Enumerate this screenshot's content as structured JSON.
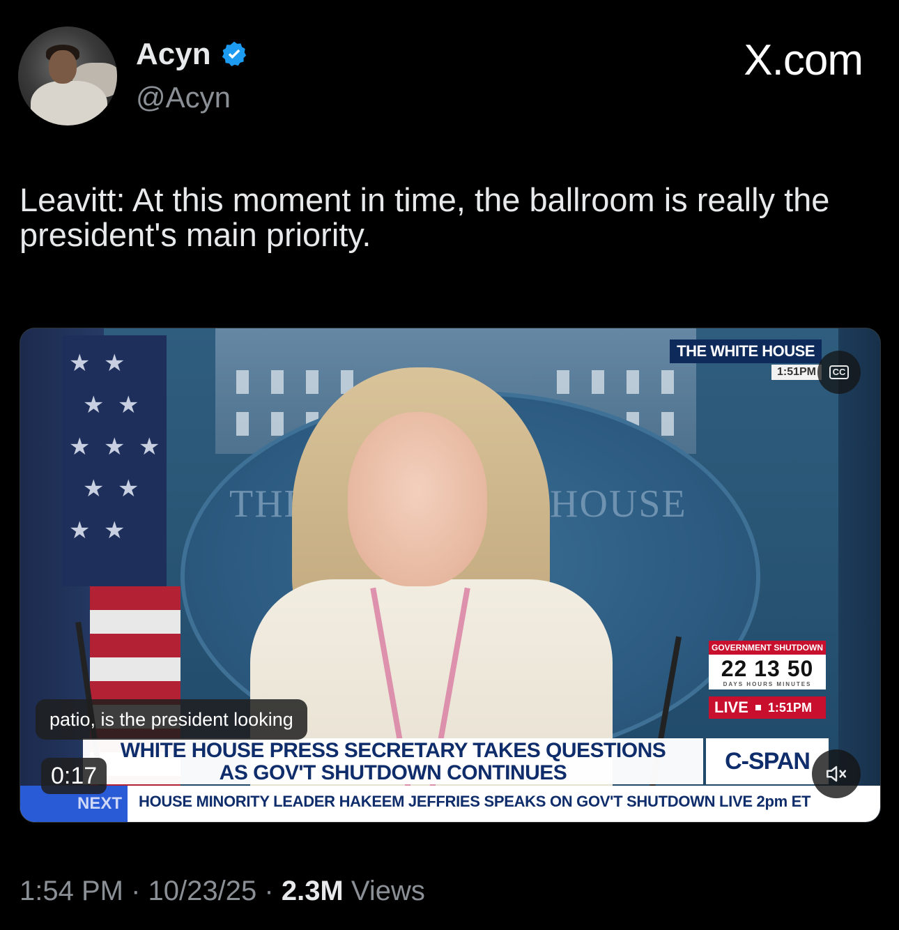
{
  "author": {
    "display_name": "Acyn",
    "handle": "@Acyn",
    "verified": true
  },
  "site_mark": "X.com",
  "tweet": {
    "text": "Leavitt: At this moment in time, the ballroom is really the president's main priority."
  },
  "video": {
    "overlay_top_label": "THE WHITE HOUSE",
    "overlay_top_time": "1:51PM",
    "backdrop_text_left": "THE W",
    "backdrop_text_right": "HOUSE",
    "shutdown_title": "GOVERNMENT SHUTDOWN",
    "shutdown_digits": "22 13 50",
    "shutdown_units": "DAYS HOURS MINUTES",
    "live_label": "LIVE",
    "live_time": "1:51PM",
    "headline_line1": "WHITE HOUSE PRESS SECRETARY TAKES QUESTIONS",
    "headline_line2": "AS GOV'T SHUTDOWN CONTINUES",
    "network_logo": "C-SPAN",
    "ticker_label": "NEXT",
    "ticker_text": "HOUSE MINORITY LEADER HAKEEM JEFFRIES SPEAKS ON GOV'T SHUTDOWN  LIVE 2pm ET",
    "caption": "patio, is the president looking",
    "timer": "0:17",
    "cc_label": "CC"
  },
  "meta": {
    "time": "1:54 PM",
    "date": "10/23/25",
    "separator": "·",
    "views_count": "2.3M",
    "views_label": "Views"
  },
  "colors": {
    "background": "#000000",
    "text_primary": "#e7e9ea",
    "text_secondary": "#8b9096",
    "verified_blue": "#1d9bf0",
    "cspan_navy": "#0f2c6b",
    "cspan_red": "#c8102e"
  }
}
